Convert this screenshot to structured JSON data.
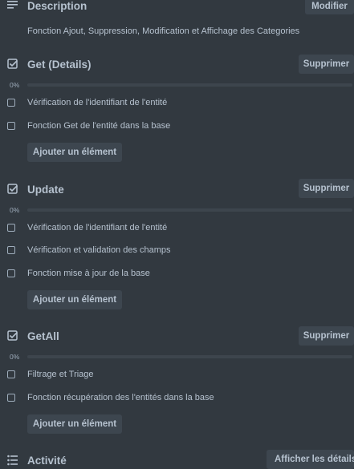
{
  "description": {
    "title": "Description",
    "edit_button": "Modifier",
    "text": "Fonction Ajout, Suppression, Modification et Affichage des Categories"
  },
  "checklists": [
    {
      "title": "Get (Details)",
      "delete_label": "Supprimer",
      "progress_label": "0%",
      "progress": 0,
      "items": [
        {
          "label": "Vérification de l'identifiant de l'entité",
          "checked": false
        },
        {
          "label": "Fonction Get de l'entité dans la base",
          "checked": false
        }
      ],
      "add_label": "Ajouter un élément"
    },
    {
      "title": "Update",
      "delete_label": "Supprimer",
      "progress_label": "0%",
      "progress": 0,
      "items": [
        {
          "label": "Vérification de l'identifiant de l'entité",
          "checked": false
        },
        {
          "label": "Vérification et validation des champs",
          "checked": false
        },
        {
          "label": "Fonction mise à jour de la base",
          "checked": false
        }
      ],
      "add_label": "Ajouter un élément"
    },
    {
      "title": "GetAll",
      "delete_label": "Supprimer",
      "progress_label": "0%",
      "progress": 0,
      "items": [
        {
          "label": "Filtrage et Triage",
          "checked": false
        },
        {
          "label": "Fonction récupération  des l'entités dans la base",
          "checked": false
        }
      ],
      "add_label": "Ajouter un élément"
    }
  ],
  "activity": {
    "title": "Activité",
    "details_button": "Afficher les détails"
  }
}
